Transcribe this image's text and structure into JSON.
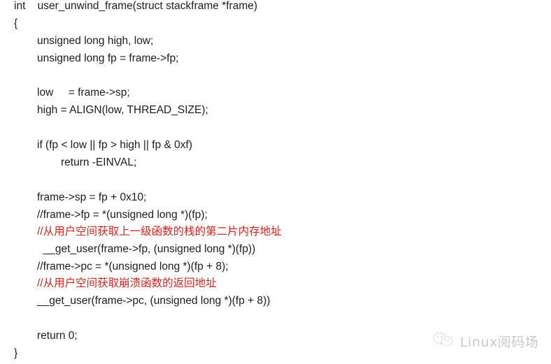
{
  "code": {
    "lines": [
      {
        "text": "int    user_unwind_frame(struct stackframe *frame)",
        "kind": "code",
        "indent": 0
      },
      {
        "text": "{",
        "kind": "code",
        "indent": 0
      },
      {
        "text": "unsigned long high, low;",
        "kind": "code",
        "indent": 1
      },
      {
        "text": "unsigned long fp = frame->fp;",
        "kind": "code",
        "indent": 1
      },
      {
        "text": "",
        "kind": "blank",
        "indent": 1
      },
      {
        "text": "low     = frame->sp;",
        "kind": "code",
        "indent": 1
      },
      {
        "text": "high = ALIGN(low, THREAD_SIZE);",
        "kind": "code",
        "indent": 1
      },
      {
        "text": "",
        "kind": "blank",
        "indent": 1
      },
      {
        "text": "if (fp < low || fp > high || fp & 0xf)",
        "kind": "code",
        "indent": 1
      },
      {
        "text": "return -EINVAL;",
        "kind": "code",
        "indent": 2
      },
      {
        "text": "",
        "kind": "blank",
        "indent": 1
      },
      {
        "text": "frame->sp = fp + 0x10;",
        "kind": "code",
        "indent": 1
      },
      {
        "text": "//frame->fp = *(unsigned long *)(fp);",
        "kind": "code",
        "indent": 1
      },
      {
        "text": "//从用户空间获取上一级函数的栈的第二片内存地址",
        "kind": "comment",
        "indent": 1
      },
      {
        "text": "  __get_user(frame->fp, (unsigned long *)(fp))",
        "kind": "code",
        "indent": 1
      },
      {
        "text": "//frame->pc = *(unsigned long *)(fp + 8);",
        "kind": "code",
        "indent": 1
      },
      {
        "text": "//从用户空间获取崩溃函数的返回地址",
        "kind": "comment",
        "indent": 1
      },
      {
        "text": "__get_user(frame->pc, (unsigned long *)(fp + 8))",
        "kind": "code",
        "indent": 1
      },
      {
        "text": "",
        "kind": "blank",
        "indent": 1
      },
      {
        "text": "return 0;",
        "kind": "code",
        "indent": 1
      },
      {
        "text": "}",
        "kind": "code",
        "indent": 0
      }
    ]
  },
  "colors": {
    "text": "#1c1c1c",
    "comment": "#d7221f",
    "watermark": "#c9c9c9"
  },
  "watermark": {
    "icon": "wechat-icon",
    "text": "Linux阅码场"
  }
}
